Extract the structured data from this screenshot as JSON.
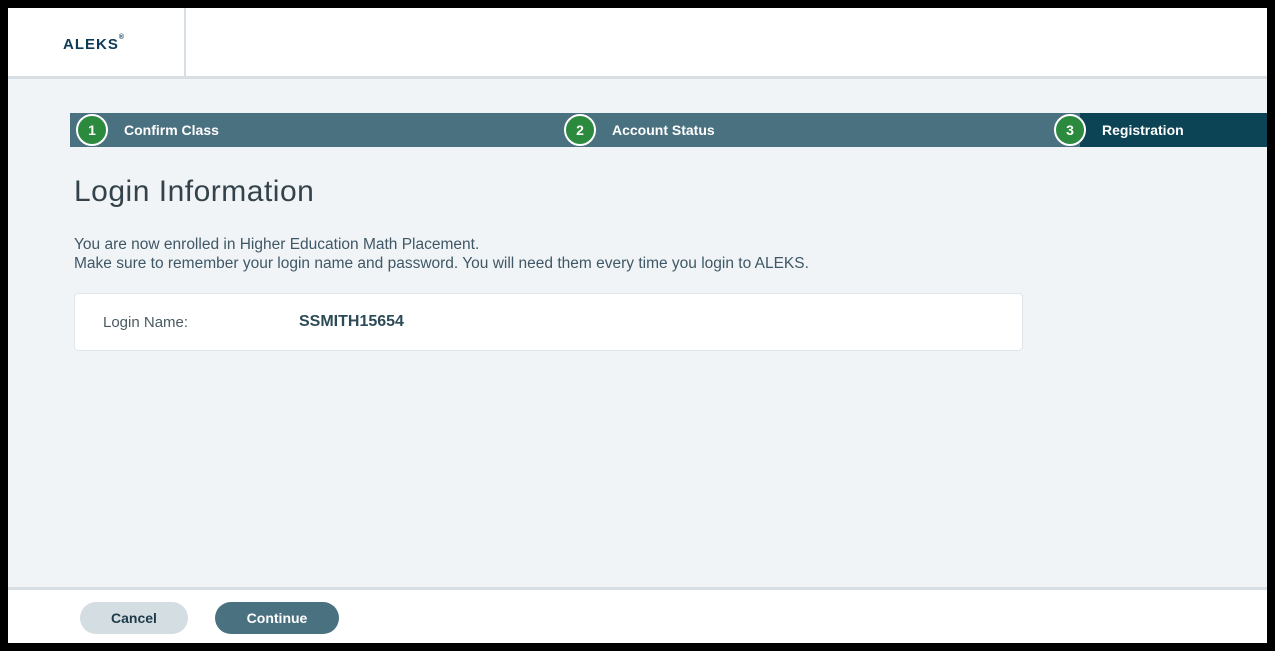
{
  "header": {
    "logo_text": "ALEKS",
    "logo_mark": "®"
  },
  "steps": [
    {
      "number": "1",
      "label": "Confirm Class",
      "active": false
    },
    {
      "number": "2",
      "label": "Account Status",
      "active": false
    },
    {
      "number": "3",
      "label": "Registration",
      "active": true
    }
  ],
  "main": {
    "title": "Login Information",
    "message_line1": "You are now enrolled in Higher Education Math Placement.",
    "message_line2": "Make sure to remember your login name and password. You will need them every time you login to ALEKS.",
    "login_label": "Login Name:",
    "login_value": "SSMITH15654"
  },
  "footer": {
    "cancel_label": "Cancel",
    "continue_label": "Continue"
  },
  "colors": {
    "step_bar": "#4a7180",
    "step_active": "#0c4456",
    "step_circle": "#2c8a3e",
    "brand": "#0c3a57"
  }
}
